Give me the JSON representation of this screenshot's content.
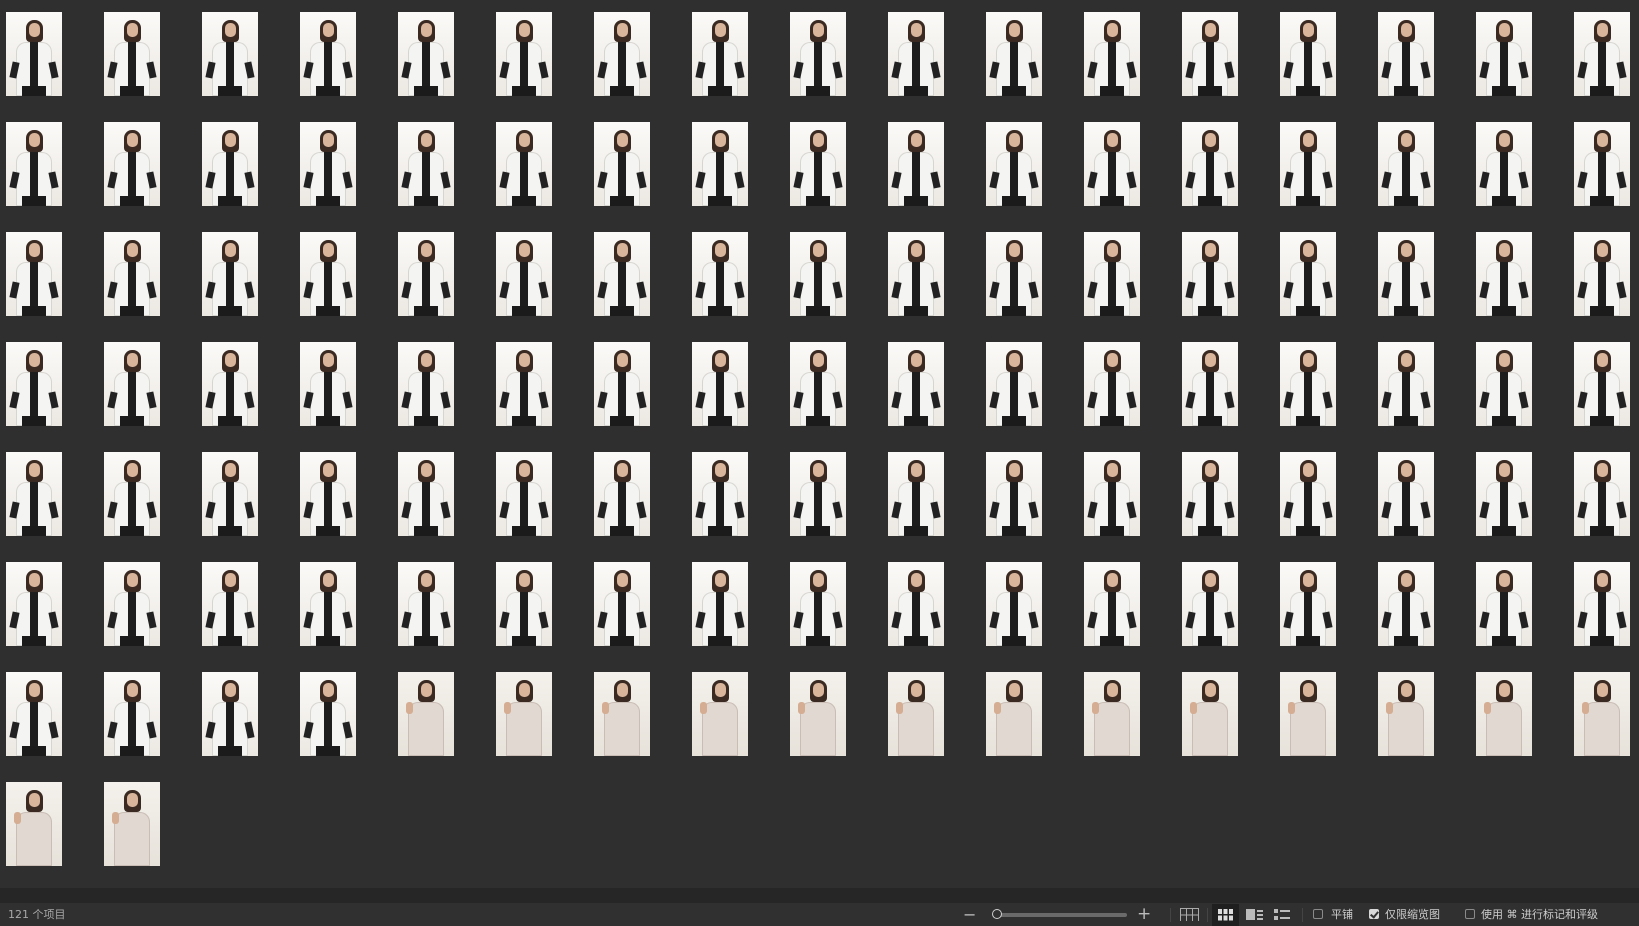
{
  "item_count_label": "121 个项目",
  "thumbnail_groups": [
    {
      "variant": "jacket",
      "count": 106
    },
    {
      "variant": "shirt",
      "count": 15
    }
  ],
  "toolbar": {
    "zoom_out": "−",
    "zoom_in": "+",
    "zoom_level": 0.03,
    "tile_label": "平铺",
    "tile_checked": false,
    "thumbnails_only_label": "仅限缩览图",
    "thumbnails_only_checked": true,
    "use_cmd_label": "使用 ⌘ 进行标记和评级",
    "use_cmd_checked": false
  }
}
